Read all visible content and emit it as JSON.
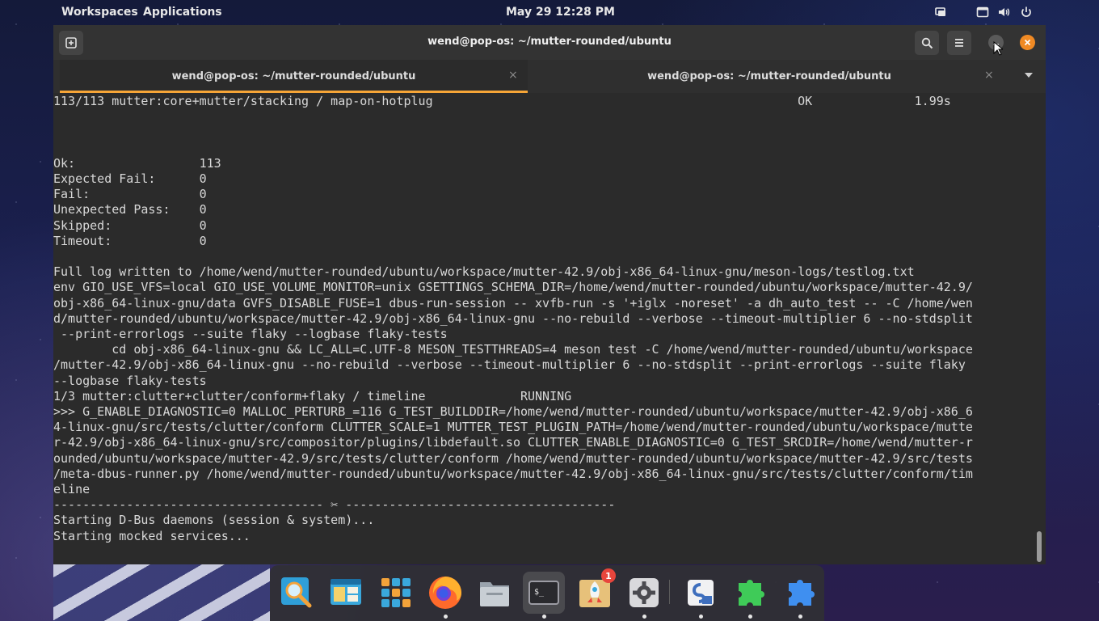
{
  "topbar": {
    "workspaces": "Workspaces",
    "applications": "Applications",
    "clock": "May 29  12:28 PM",
    "tray_icons": [
      "screen-share-icon",
      "window-icon",
      "volume-icon",
      "power-icon"
    ]
  },
  "window": {
    "title": "wend@pop-os: ~/mutter-rounded/ubuntu",
    "header_buttons": [
      "new-tab-icon",
      "search-icon",
      "menu-icon",
      "minimize-button",
      "close-button"
    ],
    "close_color": "#f08a24"
  },
  "tabs": [
    {
      "label": "wend@pop-os: ~/mutter-rounded/ubuntu",
      "close": "×",
      "active": true
    },
    {
      "label": "wend@pop-os: ~/mutter-rounded/ubuntu",
      "close": "×",
      "active": false
    }
  ],
  "accent": "#f6a537",
  "terminal": {
    "lines": [
      "113/113 mutter:core+mutter/stacking / map-on-hotplug                                                  OK              1.99s",
      "",
      "",
      "",
      "Ok:                 113",
      "Expected Fail:      0",
      "Fail:               0",
      "Unexpected Pass:    0",
      "Skipped:            0",
      "Timeout:            0",
      "",
      "Full log written to /home/wend/mutter-rounded/ubuntu/workspace/mutter-42.9/obj-x86_64-linux-gnu/meson-logs/testlog.txt",
      "env GIO_USE_VFS=local GIO_USE_VOLUME_MONITOR=unix GSETTINGS_SCHEMA_DIR=/home/wend/mutter-rounded/ubuntu/workspace/mutter-42.9/",
      "obj-x86_64-linux-gnu/data GVFS_DISABLE_FUSE=1 dbus-run-session -- xvfb-run -s '+iglx -noreset' -a dh_auto_test -- -C /home/wen",
      "d/mutter-rounded/ubuntu/workspace/mutter-42.9/obj-x86_64-linux-gnu --no-rebuild --verbose --timeout-multiplier 6 --no-stdsplit",
      " --print-errorlogs --suite flaky --logbase flaky-tests",
      "        cd obj-x86_64-linux-gnu && LC_ALL=C.UTF-8 MESON_TESTTHREADS=4 meson test -C /home/wend/mutter-rounded/ubuntu/workspace",
      "/mutter-42.9/obj-x86_64-linux-gnu --no-rebuild --verbose --timeout-multiplier 6 --no-stdsplit --print-errorlogs --suite flaky",
      "--logbase flaky-tests",
      "1/3 mutter:clutter+clutter/conform+flaky / timeline             RUNNING",
      ">>> G_ENABLE_DIAGNOSTIC=0 MALLOC_PERTURB_=116 G_TEST_BUILDDIR=/home/wend/mutter-rounded/ubuntu/workspace/mutter-42.9/obj-x86_6",
      "4-linux-gnu/src/tests/clutter/conform CLUTTER_SCALE=1 MUTTER_TEST_PLUGIN_PATH=/home/wend/mutter-rounded/ubuntu/workspace/mutte",
      "r-42.9/obj-x86_64-linux-gnu/src/compositor/plugins/libdefault.so CLUTTER_ENABLE_DIAGNOSTIC=0 G_TEST_SRCDIR=/home/wend/mutter-r",
      "ounded/ubuntu/workspace/mutter-42.9/src/tests/clutter/conform /home/wend/mutter-rounded/ubuntu/workspace/mutter-42.9/src/tests",
      "/meta-dbus-runner.py /home/wend/mutter-rounded/ubuntu/workspace/mutter-42.9/obj-x86_64-linux-gnu/src/tests/clutter/conform/tim",
      "eline",
      "------------------------------------- ✂ -------------------------------------",
      "Starting D-Bus daemons (session & system)...",
      "Starting mocked services..."
    ]
  },
  "dock": {
    "items": [
      {
        "name": "search-app",
        "icon": "magnifier-icon",
        "running": false
      },
      {
        "name": "workspaces-app",
        "icon": "window-layout-icon",
        "running": false
      },
      {
        "name": "app-grid",
        "icon": "app-grid-icon",
        "running": false
      },
      {
        "name": "firefox",
        "icon": "firefox-icon",
        "running": true
      },
      {
        "name": "files",
        "icon": "folder-icon",
        "running": false
      },
      {
        "name": "terminal",
        "icon": "terminal-icon",
        "running": true
      },
      {
        "name": "pop-shop",
        "icon": "rocket-icon",
        "running": false,
        "badge": "1"
      },
      {
        "name": "settings",
        "icon": "gear-icon",
        "running": true
      },
      {
        "name": "system-monitor",
        "icon": "monitor-icon",
        "running": true
      },
      {
        "name": "extensions",
        "icon": "green-puzzle-icon",
        "running": true
      },
      {
        "name": "extension-manager",
        "icon": "blue-puzzle-icon",
        "running": true
      }
    ],
    "badge_text": "1"
  }
}
